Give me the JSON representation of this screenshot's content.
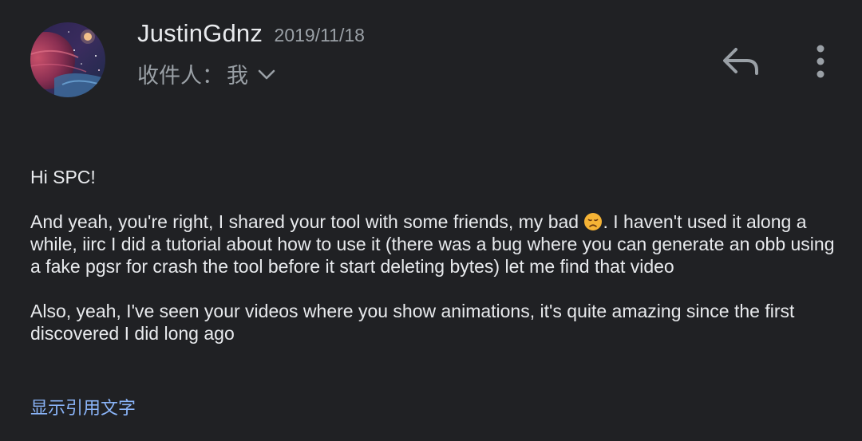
{
  "header": {
    "sender_name": "JustinGdnz",
    "date": "2019/11/18",
    "recipient_label": "收件人：",
    "recipient_value": "我",
    "icons": {
      "avatar": "avatar-image",
      "recipient_toggle": "chevron-down-icon",
      "reply": "reply-icon",
      "more": "more-vert-icon"
    }
  },
  "message": {
    "greeting": "Hi SPC!",
    "para1_before_emoji": "And yeah, you're right, I shared your tool with some friends, my bad ",
    "para1_emoji": "disappointed-face-emoji",
    "para1_after_emoji": ". I haven't used it along a while, iirc I did a tutorial about how to use it (there was a bug where you can generate an obb using a fake pgsr for crash the tool before it start deleting bytes) let me find that video",
    "para2": "Also, yeah, I've seen your videos where you show animations, it's quite amazing since the first discovered I did long ago"
  },
  "footer": {
    "show_quoted_text": "显示引用文字"
  },
  "colors": {
    "background": "#202124",
    "primary_text": "#e8eaed",
    "secondary_text": "#9aa0a6",
    "link": "#8ab4f8"
  }
}
